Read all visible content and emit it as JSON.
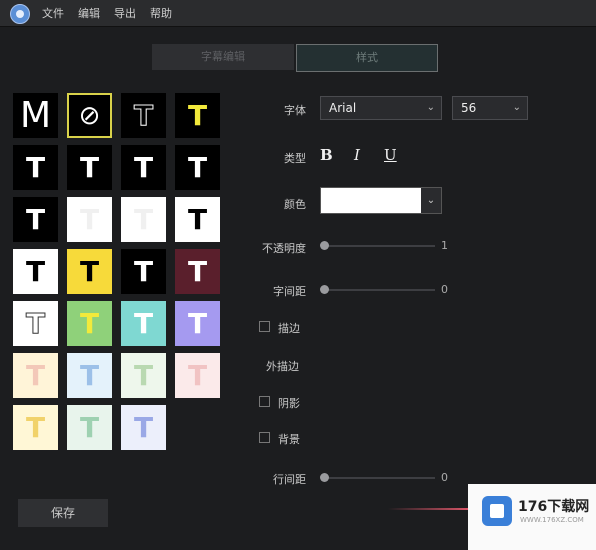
{
  "menu": {
    "file": "文件",
    "edit": "编辑",
    "export": "导出",
    "help": "帮助"
  },
  "tabs": {
    "subtitle_edit": "字幕编辑",
    "style": "样式"
  },
  "tiles": [
    {
      "glyph": "M",
      "bg": "#000000",
      "fg": "#ffffff"
    },
    {
      "glyph": "⊘",
      "bg": "#000000",
      "fg": "#ffffff"
    },
    {
      "glyph": "T",
      "bg": "#000000",
      "fg": "#000000"
    },
    {
      "glyph": "T",
      "bg": "#000000",
      "fg": "#f2e93b"
    },
    {
      "glyph": "T",
      "bg": "#000000",
      "fg": "#ffffff"
    },
    {
      "glyph": "T",
      "bg": "#000000",
      "fg": "#ffffff"
    },
    {
      "glyph": "T",
      "bg": "#000000",
      "fg": "#ffffff"
    },
    {
      "glyph": "T",
      "bg": "#000000",
      "fg": "#ffffff"
    },
    {
      "glyph": "T",
      "bg": "#000000",
      "fg": "#ffffff"
    },
    {
      "glyph": "T",
      "bg": "#ffffff",
      "fg": "#f0f0f0"
    },
    {
      "glyph": "T",
      "bg": "#ffffff",
      "fg": "#f0f0f0"
    },
    {
      "glyph": "T",
      "bg": "#ffffff",
      "fg": "#000000"
    },
    {
      "glyph": "T",
      "bg": "#ffffff",
      "fg": "#000000"
    },
    {
      "glyph": "T",
      "bg": "#f7da3a",
      "fg": "#000000"
    },
    {
      "glyph": "T",
      "bg": "#000000",
      "fg": "#ffffff"
    },
    {
      "glyph": "T",
      "bg": "#5a1f2c",
      "fg": "#ffffff"
    },
    {
      "glyph": "T",
      "bg": "#ffffff",
      "fg": "#ffffff"
    },
    {
      "glyph": "T",
      "bg": "#8fd17a",
      "fg": "#f2ea3b"
    },
    {
      "glyph": "T",
      "bg": "#7fd8d2",
      "fg": "#ffffff"
    },
    {
      "glyph": "T",
      "bg": "#a59af0",
      "fg": "#ffffff"
    },
    {
      "glyph": "T",
      "bg": "#fff4d8",
      "fg": "#f3c8b8"
    },
    {
      "glyph": "T",
      "bg": "#e4f2fb",
      "fg": "#9cc0e8"
    },
    {
      "glyph": "T",
      "bg": "#eef7ec",
      "fg": "#b9d9b1"
    },
    {
      "glyph": "T",
      "bg": "#fbeaea",
      "fg": "#f1c3c3"
    },
    {
      "glyph": "T",
      "bg": "#fff7d6",
      "fg": "#f1d26a"
    },
    {
      "glyph": "T",
      "bg": "#e8f4ec",
      "fg": "#9ed1b1"
    },
    {
      "glyph": "T",
      "bg": "#eceffb",
      "fg": "#9aa8e6"
    }
  ],
  "panel": {
    "font_label": "字体",
    "font_value": "Arial",
    "size_value": "56",
    "type_label": "类型",
    "bold": "B",
    "italic": "I",
    "underline": "U",
    "color_label": "颜色",
    "color_value": "#ffffff",
    "opacity_label": "不透明度",
    "opacity_value": "1",
    "letter_spacing_label": "字间距",
    "letter_spacing_value": "0",
    "stroke_label": "描边",
    "outer_stroke_label": "外描边",
    "shadow_label": "阴影",
    "background_label": "背景",
    "line_spacing_label": "行间距",
    "line_spacing_value": "0"
  },
  "save_label": "保存",
  "watermark": {
    "brand": "176下载网",
    "url": "WWW.176XZ.COM"
  }
}
